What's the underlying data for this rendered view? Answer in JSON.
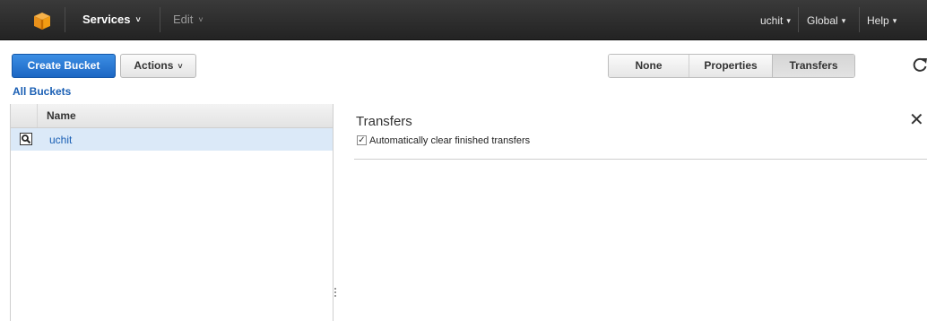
{
  "nav": {
    "services_label": "Services",
    "edit_label": "Edit",
    "user_label": "uchit",
    "region_label": "Global",
    "help_label": "Help",
    "caret": "˅"
  },
  "toolbar": {
    "create_bucket_label": "Create Bucket",
    "actions_label": "Actions",
    "actions_caret": "˅",
    "view_options": [
      "None",
      "Properties",
      "Transfers"
    ],
    "selected_view": "Transfers"
  },
  "breadcrumb": {
    "all_buckets_label": "All Buckets"
  },
  "bucket_table": {
    "column_header": "Name",
    "rows": [
      {
        "name": "uchit",
        "icon": "magnifier-icon",
        "selected": true
      }
    ]
  },
  "transfers_panel": {
    "title": "Transfers",
    "close_glyph": "✕",
    "checkbox_label": "Automatically clear finished transfers",
    "checkbox_checked": true,
    "check_glyph": "✓"
  },
  "colors": {
    "topbar": "#232323",
    "primary_button": "#1c66c3",
    "link": "#1a5fb4",
    "selected_row": "#dbe9f8",
    "logo": "#f39c12"
  }
}
